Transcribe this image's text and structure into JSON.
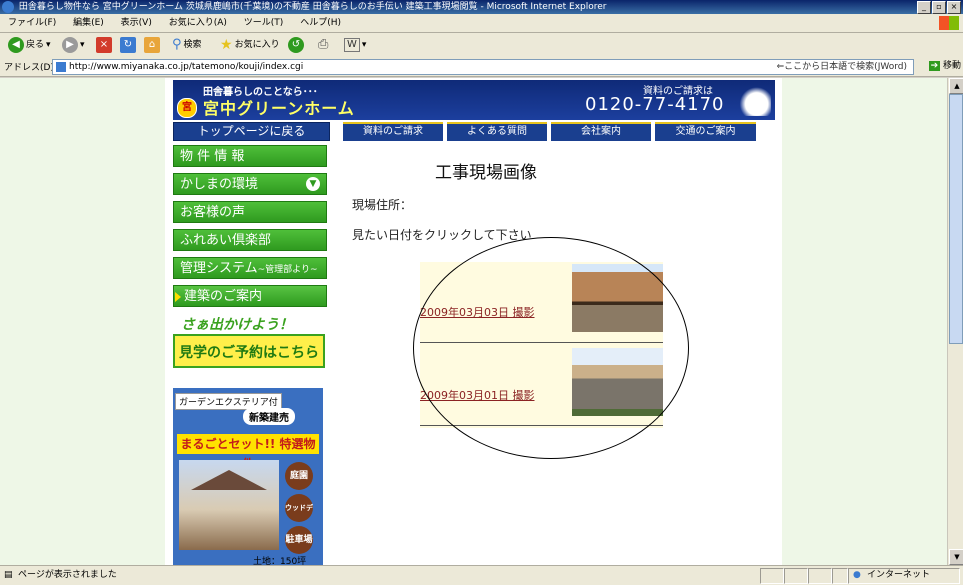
{
  "window": {
    "title": "田舎暮らし物件なら 宮中グリーンホーム 茨城県鹿嶋市(千葉境)の不動産 田舎暮らしのお手伝い 建築工事現場閲覧 - Microsoft Internet Explorer",
    "btn_min": "_",
    "btn_max": "▫",
    "btn_close": "×"
  },
  "menu": [
    "ファイル(F)",
    "編集(E)",
    "表示(V)",
    "お気に入り(A)",
    "ツール(T)",
    "ヘルプ(H)"
  ],
  "toolbar": {
    "back": "戻る",
    "search": "検索",
    "favorites": "お気に入り",
    "mail": "W"
  },
  "address": {
    "label": "アドレス(D)",
    "url": "http://www.miyanaka.co.jp/tatemono/kouji/index.cgi",
    "jpsearch": "⇐ここから日本語で検索(JWord)",
    "go": "移動"
  },
  "status": {
    "text": "ページが表示されました",
    "zone": "インターネット"
  },
  "header": {
    "tagline": "田舎暮らしのことなら･･･",
    "brand": "宮中グリーンホーム",
    "request": "資料のご請求は",
    "tel": "0120-77-4170",
    "logo_mark": "宮"
  },
  "nav": {
    "top_back": "トップページに戻る",
    "tabs": [
      "資料のご請求",
      "よくある質問",
      "会社案内",
      "交通のご案内"
    ]
  },
  "side": {
    "items": [
      {
        "label": "物 件 情 報"
      },
      {
        "label": "かしまの環境"
      },
      {
        "label": "お客様の声"
      },
      {
        "label": "ふれあい倶楽部"
      },
      {
        "label": "管理システム",
        "sub": "~管理部より~"
      },
      {
        "label": "建築のご案内"
      }
    ],
    "visit_top": "さぁ出かけよう！",
    "visit_btn": "見学のご予約はこちら"
  },
  "promo": {
    "tag": "ガーデンエクステリア付",
    "new": "新築建売",
    "set": "まるごとセット!! 特選物件",
    "badges": [
      "庭園",
      "ウッドデッキ",
      "駐車場"
    ],
    "land": "土地：150坪"
  },
  "content": {
    "title": "工事現場画像",
    "site_label": "現場住所：",
    "instruction": "見たい日付をクリックして下さい",
    "photos": [
      {
        "label": "2009年03月03日 撮影"
      },
      {
        "label": "2009年03月01日 撮影"
      }
    ]
  }
}
